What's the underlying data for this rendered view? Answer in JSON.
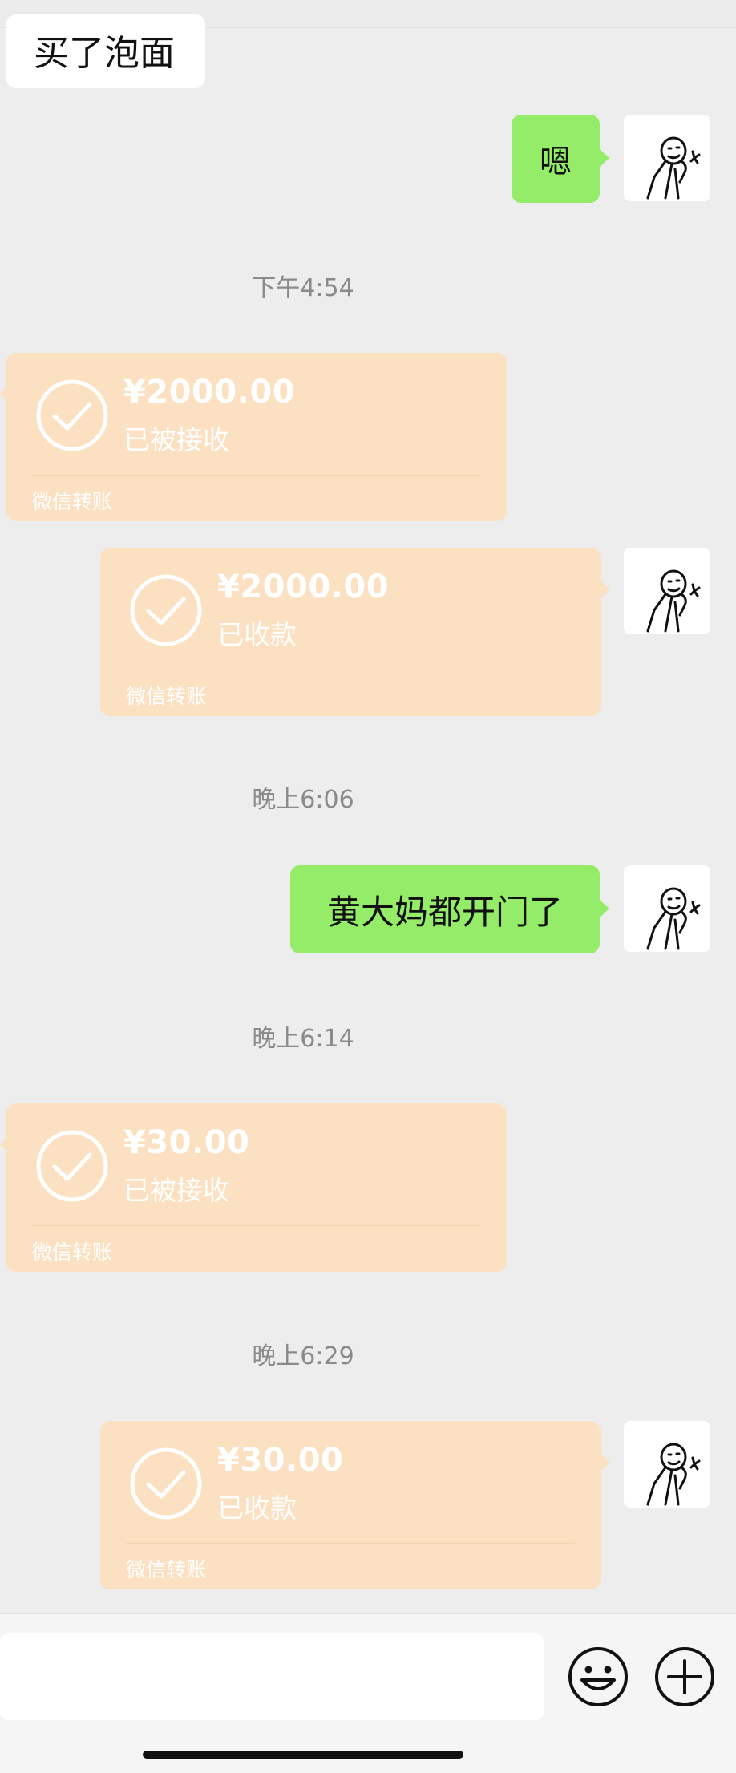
{
  "messages": {
    "m1_text": "买了泡面",
    "m2_text": "嗯",
    "t1": "下午4:54",
    "tr1": {
      "amount": "¥2000.00",
      "status": "已被接收",
      "label": "微信转账"
    },
    "tr2": {
      "amount": "¥2000.00",
      "status": "已收款",
      "label": "微信转账"
    },
    "t2": "晚上6:06",
    "m3_text": "黄大妈都开门了",
    "t3": "晚上6:14",
    "tr3": {
      "amount": "¥30.00",
      "status": "已被接收",
      "label": "微信转账"
    },
    "t4": "晚上6:29",
    "tr4": {
      "amount": "¥30.00",
      "status": "已收款",
      "label": "微信转账"
    }
  },
  "icons": {
    "emoji": "emoji-icon",
    "plus": "plus-icon",
    "check": "check-circle-icon"
  },
  "colors": {
    "bg": "#ededed",
    "green_bubble": "#95ec69",
    "transfer": "#fbe1c2"
  }
}
